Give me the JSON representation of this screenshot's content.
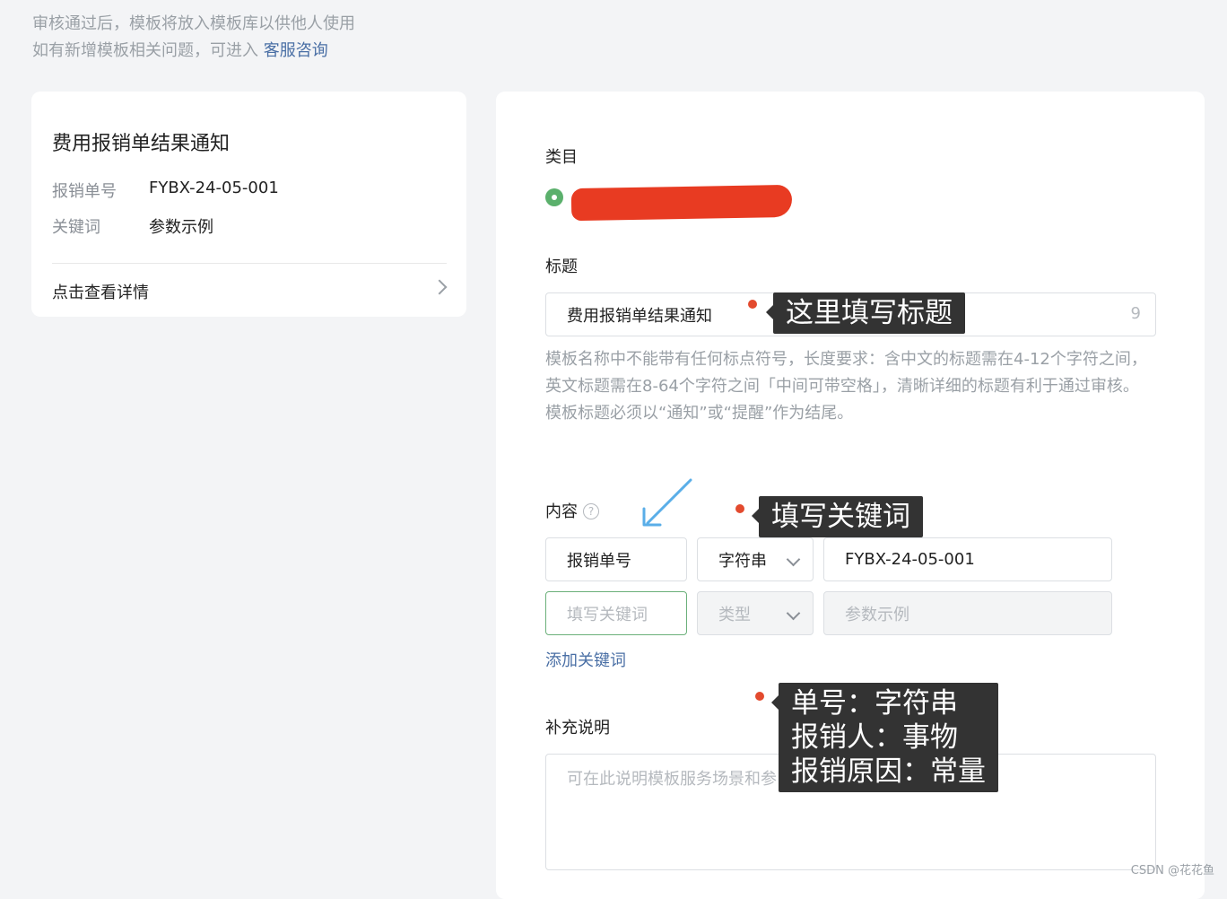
{
  "notices": {
    "line1": "审核通过后，模板将放入模板库以供他人使用",
    "line2_prefix": "如有新增模板相关问题，可进入",
    "line2_link": "客服咨询"
  },
  "preview": {
    "title": "费用报销单结果通知",
    "fields": [
      {
        "key": "报销单号",
        "value": "FYBX-24-05-001"
      },
      {
        "key": "关键词",
        "value": "参数示例"
      }
    ],
    "detail_label": "点击查看详情"
  },
  "form": {
    "category_label": "类目",
    "title_label": "标题",
    "title_value": "费用报销单结果通知",
    "title_count": "9",
    "title_help": [
      "模板名称中不能带有任何标点符号，长度要求：含中文的标题需在4-12个字符之间，英文标题需在8-64个字符之间「中间可带空格」，清晰详细的标题有利于通过审核。",
      "模板标题必须以“通知”或“提醒”作为结尾。"
    ],
    "content_label": "内容",
    "help_icon": "?",
    "rows": [
      {
        "name": "报销单号",
        "type": "字符串",
        "example": "FYBX-24-05-001"
      }
    ],
    "new_row": {
      "name_placeholder": "填写关键词",
      "type_placeholder": "类型",
      "example_placeholder": "参数示例"
    },
    "add_keyword": "添加关键词",
    "supplement_label": "补充说明",
    "supplement_placeholder": "可在此说明模板服务场景和参"
  },
  "annotations": {
    "title_tip": "这里填写标题",
    "keyword_tip": "填写关键词",
    "type_tip": "单号：字符串\n报销人：事物\n报销原因：常量",
    "arrow_color": "#5aaee8",
    "dot_color": "#e34a2e"
  },
  "watermark": "CSDN @花花鱼"
}
